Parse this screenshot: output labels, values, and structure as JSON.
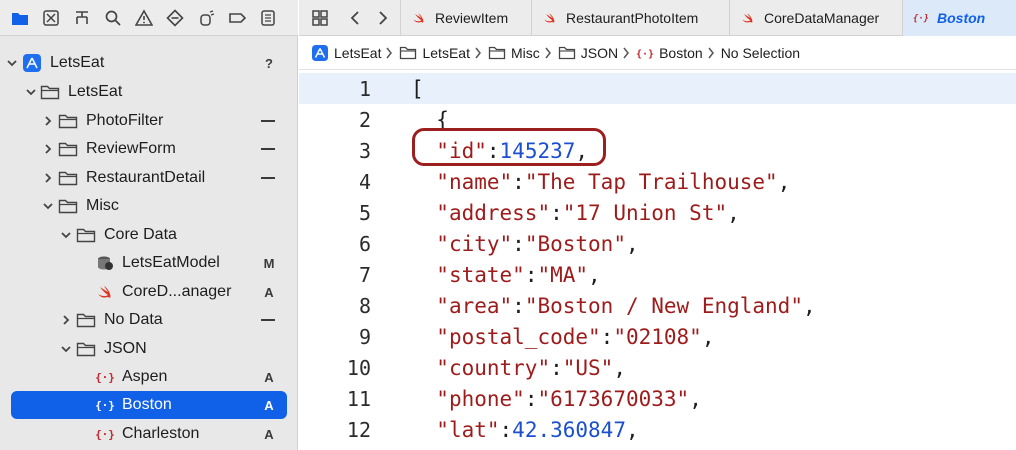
{
  "navigator": {
    "toolbar_icons": [
      "folder-icon",
      "source-control-icon",
      "hierarchy-icon",
      "search-icon",
      "warning-icon",
      "test-icon",
      "debug-icon",
      "breakpoint-icon",
      "report-icon"
    ],
    "tree": [
      {
        "label": "LetsEat",
        "status": "?",
        "icon": "app-project-icon",
        "expanded": true
      },
      {
        "label": "LetsEat",
        "status": "",
        "icon": "folder-icon",
        "expanded": true
      },
      {
        "label": "PhotoFilter",
        "status": "—",
        "icon": "folder-icon",
        "expanded": false
      },
      {
        "label": "ReviewForm",
        "status": "—",
        "icon": "folder-icon",
        "expanded": false
      },
      {
        "label": "RestaurantDetail",
        "status": "—",
        "icon": "folder-icon",
        "expanded": false
      },
      {
        "label": "Misc",
        "status": "",
        "icon": "folder-icon",
        "expanded": true
      },
      {
        "label": "Core Data",
        "status": "",
        "icon": "folder-icon",
        "expanded": true
      },
      {
        "label": "LetsEatModel",
        "status": "M",
        "icon": "core-data-model-icon"
      },
      {
        "label": "CoreD...anager",
        "status": "A",
        "icon": "swift-icon"
      },
      {
        "label": "No Data",
        "status": "—",
        "icon": "folder-icon",
        "expanded": false
      },
      {
        "label": "JSON",
        "status": "",
        "icon": "folder-icon",
        "expanded": true
      },
      {
        "label": "Aspen",
        "status": "A",
        "icon": "json-file-icon"
      },
      {
        "label": "Boston",
        "status": "A",
        "icon": "json-file-icon",
        "selected": true
      },
      {
        "label": "Charleston",
        "status": "A",
        "icon": "json-file-icon"
      }
    ]
  },
  "editor": {
    "tabs": [
      {
        "label": "ReviewItem",
        "icon": "swift-icon"
      },
      {
        "label": "RestaurantPhotoItem",
        "icon": "swift-icon"
      },
      {
        "label": "CoreDataManager",
        "icon": "swift-icon"
      },
      {
        "label": "Boston",
        "icon": "json-file-icon",
        "active": true
      }
    ],
    "breadcrumbs": [
      {
        "label": "LetsEat",
        "icon": "app-project-icon"
      },
      {
        "label": "LetsEat",
        "icon": "folder-icon"
      },
      {
        "label": "Misc",
        "icon": "folder-icon"
      },
      {
        "label": "JSON",
        "icon": "folder-icon"
      },
      {
        "label": "Boston",
        "icon": "json-file-icon"
      },
      {
        "label": "No Selection",
        "icon": ""
      }
    ],
    "code_lines": [
      {
        "n": "1",
        "tokens": [
          {
            "t": "punct",
            "v": "["
          }
        ]
      },
      {
        "n": "2",
        "tokens": [
          {
            "t": "punct",
            "v": "  {"
          }
        ]
      },
      {
        "n": "3",
        "tokens": [
          {
            "t": "punct",
            "v": "  "
          },
          {
            "t": "key",
            "v": "\"id\""
          },
          {
            "t": "punct",
            "v": ":"
          },
          {
            "t": "num",
            "v": "145237"
          },
          {
            "t": "punct",
            "v": ","
          }
        ]
      },
      {
        "n": "4",
        "tokens": [
          {
            "t": "punct",
            "v": "  "
          },
          {
            "t": "key",
            "v": "\"name\""
          },
          {
            "t": "punct",
            "v": ":"
          },
          {
            "t": "str",
            "v": "\"The Tap Trailhouse\""
          },
          {
            "t": "punct",
            "v": ","
          }
        ]
      },
      {
        "n": "5",
        "tokens": [
          {
            "t": "punct",
            "v": "  "
          },
          {
            "t": "key",
            "v": "\"address\""
          },
          {
            "t": "punct",
            "v": ":"
          },
          {
            "t": "str",
            "v": "\"17 Union St\""
          },
          {
            "t": "punct",
            "v": ","
          }
        ]
      },
      {
        "n": "6",
        "tokens": [
          {
            "t": "punct",
            "v": "  "
          },
          {
            "t": "key",
            "v": "\"city\""
          },
          {
            "t": "punct",
            "v": ":"
          },
          {
            "t": "str",
            "v": "\"Boston\""
          },
          {
            "t": "punct",
            "v": ","
          }
        ]
      },
      {
        "n": "7",
        "tokens": [
          {
            "t": "punct",
            "v": "  "
          },
          {
            "t": "key",
            "v": "\"state\""
          },
          {
            "t": "punct",
            "v": ":"
          },
          {
            "t": "str",
            "v": "\"MA\""
          },
          {
            "t": "punct",
            "v": ","
          }
        ]
      },
      {
        "n": "8",
        "tokens": [
          {
            "t": "punct",
            "v": "  "
          },
          {
            "t": "key",
            "v": "\"area\""
          },
          {
            "t": "punct",
            "v": ":"
          },
          {
            "t": "str",
            "v": "\"Boston / New England\""
          },
          {
            "t": "punct",
            "v": ","
          }
        ]
      },
      {
        "n": "9",
        "tokens": [
          {
            "t": "punct",
            "v": "  "
          },
          {
            "t": "key",
            "v": "\"postal_code\""
          },
          {
            "t": "punct",
            "v": ":"
          },
          {
            "t": "str",
            "v": "\"02108\""
          },
          {
            "t": "punct",
            "v": ","
          }
        ]
      },
      {
        "n": "10",
        "tokens": [
          {
            "t": "punct",
            "v": "  "
          },
          {
            "t": "key",
            "v": "\"country\""
          },
          {
            "t": "punct",
            "v": ":"
          },
          {
            "t": "str",
            "v": "\"US\""
          },
          {
            "t": "punct",
            "v": ","
          }
        ]
      },
      {
        "n": "11",
        "tokens": [
          {
            "t": "punct",
            "v": "  "
          },
          {
            "t": "key",
            "v": "\"phone\""
          },
          {
            "t": "punct",
            "v": ":"
          },
          {
            "t": "str",
            "v": "\"6173670033\""
          },
          {
            "t": "punct",
            "v": ","
          }
        ]
      },
      {
        "n": "12",
        "tokens": [
          {
            "t": "punct",
            "v": "  "
          },
          {
            "t": "key",
            "v": "\"lat\""
          },
          {
            "t": "punct",
            "v": ":"
          },
          {
            "t": "num",
            "v": "42.360847"
          },
          {
            "t": "punct",
            "v": ","
          }
        ]
      }
    ]
  },
  "colors": {
    "accent": "#1160e8",
    "json_key": "#9e1b1b",
    "json_number": "#1b4fcf",
    "callout": "#9c1f1f",
    "swift_icon": "#e0321e"
  }
}
